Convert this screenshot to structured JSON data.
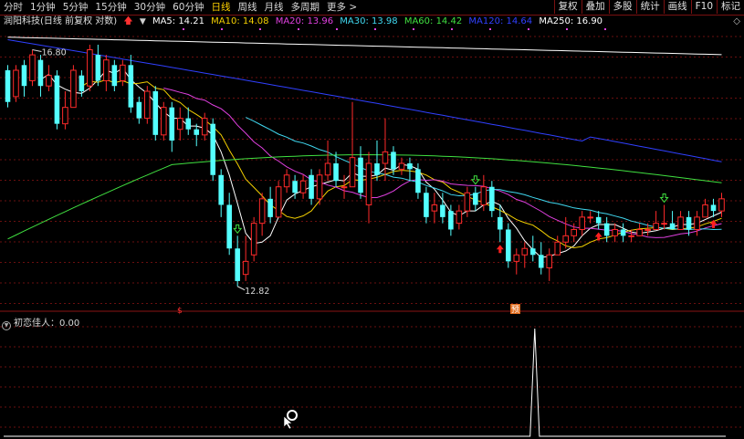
{
  "toolbar": {
    "periods": [
      "分时",
      "1分钟",
      "5分钟",
      "15分钟",
      "30分钟",
      "60分钟",
      "日线",
      "周线",
      "月线",
      "多周期",
      "更多 >"
    ],
    "active_period": "日线",
    "buttons": [
      "复权",
      "叠加",
      "多股",
      "统计",
      "画线",
      "F10",
      "标记"
    ]
  },
  "info": {
    "stock_name": "润阳科技(日线 前复权 对数)",
    "ma5": "MA5: 14.21",
    "ma10": "MA10: 14.08",
    "ma20": "MA20: 13.96",
    "ma30": "MA30: 13.98",
    "ma60": "MA60: 14.42",
    "ma120": "MA120: 14.64",
    "ma250": "MA250: 16.90"
  },
  "colors": {
    "up": "#ff2a2a",
    "down": "#54ffff",
    "ma5": "#ffffff",
    "ma10": "#f4d000",
    "ma20": "#e040e0",
    "ma30": "#40d8f0",
    "ma60": "#40e040",
    "ma120": "#3040ff",
    "ma250": "#ffffff"
  },
  "chart_data": {
    "type": "candlestick",
    "title": "润阳科技(日线 前复权 对数)",
    "y_scale": "log",
    "annotations": {
      "high_label": "16.80",
      "low_label": "12.82",
      "marker_s": "$",
      "marker_pre": "预"
    },
    "candles": [
      [
        16.5,
        15.9,
        16.6,
        15.8
      ],
      [
        16.0,
        16.5,
        16.6,
        15.9
      ],
      [
        16.6,
        16.2,
        16.7,
        16.0
      ],
      [
        16.3,
        16.8,
        16.9,
        16.2
      ],
      [
        16.7,
        16.2,
        16.8,
        16.0
      ],
      [
        16.2,
        16.4,
        16.6,
        16.1
      ],
      [
        16.4,
        15.5,
        16.5,
        15.4
      ],
      [
        15.5,
        15.8,
        16.1,
        15.4
      ],
      [
        15.8,
        16.5,
        16.6,
        15.8
      ],
      [
        16.4,
        16.1,
        16.5,
        16.0
      ],
      [
        16.2,
        16.9,
        17.0,
        16.1
      ],
      [
        16.8,
        16.3,
        17.0,
        16.2
      ],
      [
        16.3,
        16.7,
        16.8,
        16.1
      ],
      [
        16.6,
        16.2,
        16.7,
        16.1
      ],
      [
        16.3,
        16.6,
        16.7,
        16.2
      ],
      [
        16.6,
        15.8,
        16.8,
        15.7
      ],
      [
        15.9,
        15.6,
        16.0,
        15.5
      ],
      [
        15.6,
        16.1,
        16.2,
        15.5
      ],
      [
        16.1,
        15.3,
        16.2,
        15.2
      ],
      [
        15.3,
        15.8,
        15.9,
        15.2
      ],
      [
        15.8,
        15.2,
        15.9,
        15.0
      ],
      [
        15.4,
        15.6,
        15.8,
        15.2
      ],
      [
        15.6,
        15.4,
        15.8,
        15.3
      ],
      [
        15.4,
        15.3,
        15.5,
        15.1
      ],
      [
        15.3,
        15.6,
        15.7,
        15.2
      ],
      [
        15.5,
        14.6,
        15.6,
        14.5
      ],
      [
        14.6,
        14.1,
        14.7,
        13.9
      ],
      [
        14.1,
        13.4,
        14.3,
        13.3
      ],
      [
        13.4,
        12.9,
        13.6,
        12.82
      ],
      [
        13.0,
        13.2,
        13.6,
        12.9
      ],
      [
        13.3,
        13.8,
        13.9,
        13.2
      ],
      [
        13.8,
        14.2,
        14.3,
        13.6
      ],
      [
        14.2,
        13.9,
        14.4,
        13.8
      ],
      [
        13.9,
        14.4,
        14.5,
        13.9
      ],
      [
        14.4,
        14.6,
        14.7,
        14.3
      ],
      [
        14.5,
        14.3,
        14.6,
        14.2
      ],
      [
        14.3,
        14.5,
        14.6,
        14.2
      ],
      [
        14.6,
        14.2,
        14.7,
        14.1
      ],
      [
        14.2,
        14.6,
        14.7,
        14.1
      ],
      [
        14.6,
        14.8,
        15.2,
        14.5
      ],
      [
        14.8,
        14.5,
        15.0,
        14.4
      ],
      [
        14.4,
        14.4,
        14.6,
        14.2
      ],
      [
        14.4,
        14.9,
        15.9,
        14.4
      ],
      [
        14.9,
        14.3,
        15.1,
        14.2
      ],
      [
        14.1,
        14.8,
        15.0,
        13.8
      ],
      [
        14.8,
        14.6,
        15.2,
        14.5
      ],
      [
        14.8,
        15.0,
        15.6,
        14.5
      ],
      [
        15.0,
        14.7,
        15.1,
        14.6
      ],
      [
        14.7,
        14.8,
        14.9,
        14.6
      ],
      [
        14.8,
        14.7,
        14.9,
        14.5
      ],
      [
        14.7,
        14.3,
        14.8,
        14.2
      ],
      [
        14.3,
        13.9,
        14.4,
        13.8
      ],
      [
        14.0,
        14.1,
        14.3,
        13.8
      ],
      [
        14.1,
        13.9,
        14.3,
        13.8
      ],
      [
        14.0,
        13.7,
        14.1,
        13.6
      ],
      [
        13.8,
        14.0,
        14.1,
        13.7
      ],
      [
        14.0,
        14.3,
        14.4,
        13.9
      ],
      [
        14.3,
        14.1,
        14.4,
        14.0
      ],
      [
        14.1,
        14.4,
        14.6,
        14.0
      ],
      [
        14.4,
        14.0,
        14.5,
        13.9
      ],
      [
        13.9,
        13.7,
        14.1,
        13.5
      ],
      [
        13.7,
        13.2,
        13.8,
        13.1
      ],
      [
        13.2,
        13.3,
        13.4,
        13.0
      ],
      [
        13.3,
        13.4,
        13.5,
        13.1
      ],
      [
        13.4,
        13.3,
        13.6,
        13.2
      ],
      [
        13.3,
        13.1,
        13.5,
        13.0
      ],
      [
        13.1,
        13.3,
        13.4,
        12.9
      ],
      [
        13.3,
        13.5,
        13.6,
        13.3
      ],
      [
        13.5,
        13.6,
        13.9,
        13.4
      ],
      [
        13.6,
        13.7,
        13.8,
        13.5
      ],
      [
        13.7,
        13.9,
        14.0,
        13.6
      ],
      [
        13.9,
        13.9,
        14.0,
        13.8
      ],
      [
        13.9,
        13.8,
        14.0,
        13.7
      ],
      [
        13.8,
        13.6,
        13.9,
        13.5
      ],
      [
        13.6,
        13.7,
        13.8,
        13.5
      ],
      [
        13.7,
        13.6,
        13.8,
        13.5
      ],
      [
        13.6,
        13.6,
        13.7,
        13.5
      ],
      [
        13.6,
        13.7,
        13.8,
        13.6
      ],
      [
        13.7,
        13.7,
        13.8,
        13.6
      ],
      [
        13.7,
        13.8,
        14.0,
        13.7
      ],
      [
        13.8,
        13.8,
        14.1,
        13.7
      ],
      [
        13.8,
        13.7,
        14.0,
        13.7
      ],
      [
        13.7,
        13.9,
        14.0,
        13.7
      ],
      [
        13.9,
        13.7,
        14.0,
        13.6
      ],
      [
        13.7,
        13.9,
        14.0,
        13.6
      ],
      [
        13.9,
        14.1,
        14.2,
        13.9
      ],
      [
        14.1,
        14.0,
        14.2,
        13.9
      ],
      [
        14.0,
        14.2,
        14.3,
        13.9
      ]
    ]
  },
  "indicator": {
    "name": "初恋佳人",
    "label": "初恋佳人：0.00",
    "values": [
      0,
      0,
      0,
      0,
      0,
      0,
      0,
      0,
      0,
      0,
      0,
      0,
      0,
      0,
      0,
      0,
      0,
      0,
      0,
      0,
      0,
      0,
      0,
      0,
      0,
      0,
      0,
      0,
      0,
      0,
      0,
      0,
      0,
      0,
      0,
      0,
      0,
      0,
      0,
      0,
      0,
      0,
      0,
      0,
      0,
      0,
      0,
      0,
      0,
      0,
      0,
      0,
      0,
      0,
      0,
      0,
      0,
      0,
      0,
      0,
      0,
      0,
      0,
      0,
      0,
      0,
      0,
      0,
      0,
      0,
      0,
      0,
      0,
      0,
      0,
      0,
      0,
      0,
      0,
      0,
      0,
      0,
      0,
      0,
      0,
      0,
      0,
      0,
      0,
      0,
      0,
      0,
      0,
      0,
      0,
      0,
      0,
      0,
      0,
      0,
      0,
      0,
      0,
      0,
      0,
      0,
      0,
      0,
      0,
      0,
      0,
      0,
      0,
      0,
      1,
      0,
      0,
      0,
      0,
      0,
      0,
      0,
      0,
      0,
      0,
      0,
      0,
      0,
      0,
      0,
      0,
      0,
      0,
      0,
      0,
      0,
      0,
      0,
      0,
      0,
      0,
      0,
      0,
      0,
      0,
      0,
      0,
      0,
      0,
      0,
      0,
      0,
      0,
      0,
      0,
      0
    ]
  }
}
